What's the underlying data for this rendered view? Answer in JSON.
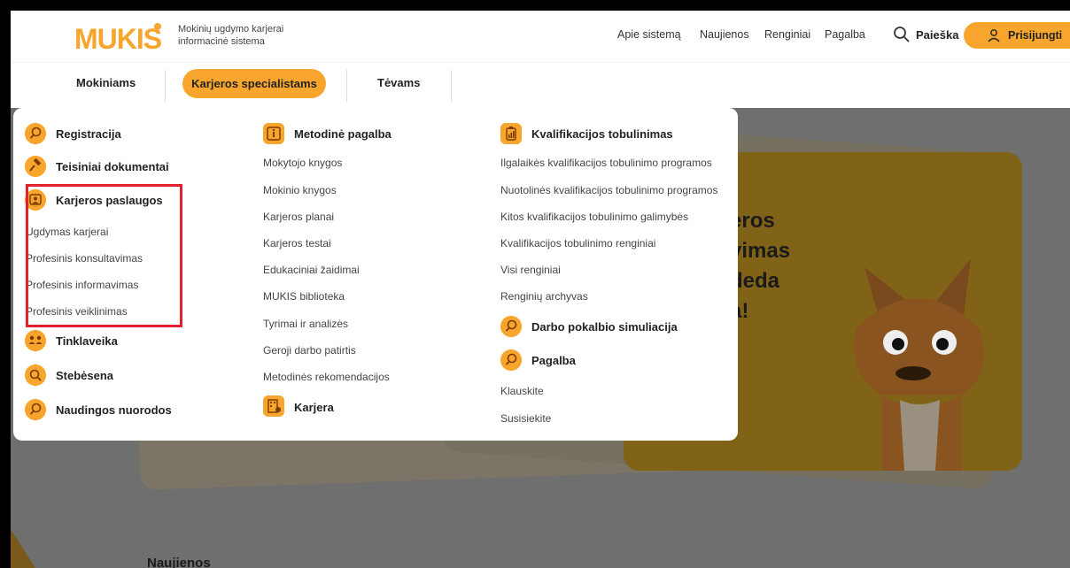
{
  "header": {
    "logo_text": "MUKIS",
    "tagline": "Mokinių ugdymo karjerai informacinė sistema",
    "nav": [
      "Apie sistemą",
      "Naujienos",
      "Renginiai",
      "Pagalba"
    ],
    "search_label": "Paieška",
    "login_label": "Prisijungti",
    "search_icon": "search-icon",
    "login_icon": "user-icon"
  },
  "secondary_nav": {
    "tabs": [
      "Mokiniams",
      "Karjeros specialistams",
      "Tėvams"
    ],
    "active": "Karjeros specialistams"
  },
  "menu": {
    "col1": {
      "items": [
        {
          "label": "Registracija",
          "icon": "search-doc-icon"
        },
        {
          "label": "Teisiniai dokumentai",
          "icon": "gavel-icon"
        },
        {
          "label": "Karjeros paslaugos",
          "icon": "person-board-icon"
        }
      ],
      "sub_links": [
        "Ugdymas karjerai",
        "Profesinis konsultavimas",
        "Profesinis informavimas",
        "Profesinis veiklinimas"
      ],
      "more_items": [
        {
          "label": "Tinklaveika",
          "icon": "people-network-icon"
        },
        {
          "label": "Stebėsena",
          "icon": "search-icon"
        },
        {
          "label": "Naudingos nuorodos",
          "icon": "search-doc-icon"
        }
      ]
    },
    "col2": {
      "heading": "Metodinė pagalba",
      "heading_icon": "info-icon",
      "links": [
        "Mokytojo knygos",
        "Mokinio knygos",
        "Karjeros planai",
        "Karjeros testai",
        "Edukaciniai žaidimai",
        "MUKIS biblioteka",
        "Tyrimai ir analizės",
        "Geroji darbo patirtis",
        "Metodinės rekomendacijos"
      ],
      "footer_heading": "Karjera",
      "footer_icon": "building-icon"
    },
    "col3": {
      "heading": "Kvalifikacijos tobulinimas",
      "heading_icon": "clipboard-chart-icon",
      "links": [
        "Ilgalaikės kvalifikacijos tobulinimo programos",
        "Nuotolinės kvalifikacijos tobulinimo programos",
        "Kitos kvalifikacijos tobulinimo galimybės",
        "Kvalifikacijos tobulinimo renginiai",
        "Visi renginiai",
        "Renginių archyvas"
      ],
      "heading2": "Darbo pokalbio simuliacija",
      "heading3": "Pagalba",
      "links2": [
        "Klauskite",
        "Susisiekite"
      ]
    }
  },
  "hero": {
    "lines": [
      "eros",
      "vimas",
      "deda",
      "a!"
    ]
  },
  "bottom": {
    "heading": "Naujienos"
  },
  "colors": {
    "accent": "#f7a52c",
    "highlight": "#e3202e"
  }
}
